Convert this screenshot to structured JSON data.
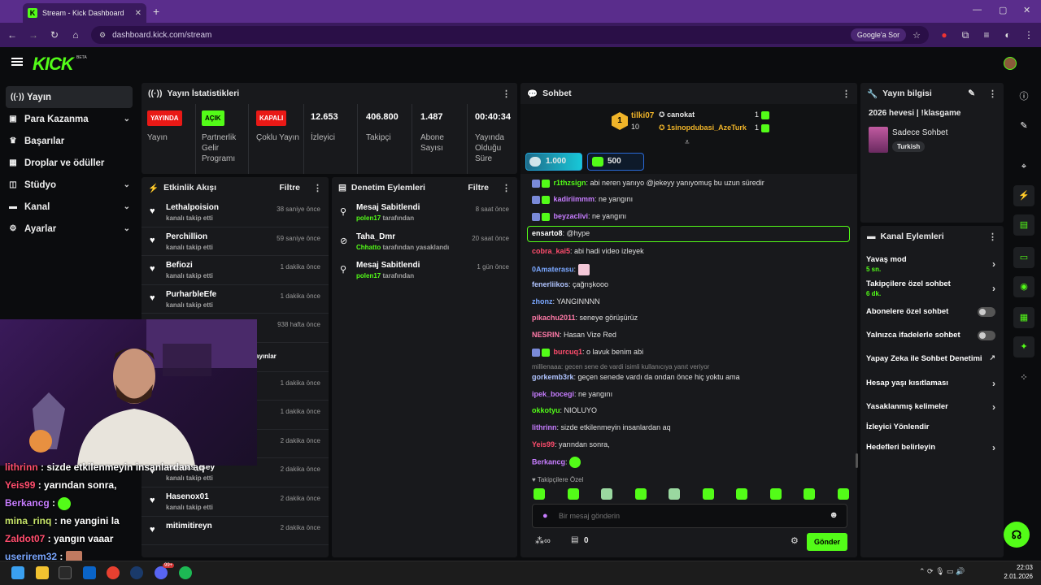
{
  "browser": {
    "tab_title": "Stream - Kick Dashboard",
    "url": "dashboard.kick.com/stream",
    "google_btn": "Google'a Sor"
  },
  "header": {
    "logo": "KICK",
    "beta": "BETA"
  },
  "sidebar": {
    "items": [
      {
        "label": "Yayın",
        "icon": "broadcast-icon",
        "expandable": false,
        "active": true
      },
      {
        "label": "Para Kazanma",
        "icon": "money-icon",
        "expandable": true
      },
      {
        "label": "Başarılar",
        "icon": "trophy-icon",
        "expandable": false
      },
      {
        "label": "Droplar ve ödüller",
        "icon": "gift-icon",
        "expandable": false
      },
      {
        "label": "Stüdyo",
        "icon": "studio-icon",
        "expandable": true
      },
      {
        "label": "Kanal",
        "icon": "channel-icon",
        "expandable": true
      },
      {
        "label": "Ayarlar",
        "icon": "gear-icon",
        "expandable": true
      }
    ]
  },
  "stats": {
    "title": "Yayın İstatistikleri",
    "cols": [
      {
        "badge": "YAYINDA",
        "badge_color": "#e91916",
        "label": "Yayın"
      },
      {
        "badge": "AÇIK",
        "badge_color": "#53fc18",
        "label": "Partnerlik Gelir Programı"
      },
      {
        "badge": "KAPALI",
        "badge_color": "#e91916",
        "label": "Çoklu Yayın"
      },
      {
        "value": "12.653",
        "label": "İzleyici"
      },
      {
        "value": "406.800",
        "label": "Takipçi"
      },
      {
        "value": "1.487",
        "label": "Abone Sayısı"
      },
      {
        "value": "00:40:34",
        "label": "Yayında Olduğu Süre"
      }
    ]
  },
  "activity": {
    "title": "Etkinlik Akışı",
    "filter": "Filtre",
    "items": [
      {
        "name": "Lethalpoision",
        "sub": "kanalı takip etti",
        "time": "38 saniye önce"
      },
      {
        "name": "Perchillion",
        "sub": "kanalı takip etti",
        "time": "59 saniye önce"
      },
      {
        "name": "Befiozi",
        "sub": "kanalı takip etti",
        "time": "1 dakika önce"
      },
      {
        "name": "PurharbleEfe",
        "sub": "kanalı takip etti",
        "time": "1 dakika önce"
      },
      {
        "name": "",
        "sub": "",
        "time": "938 hafta önce"
      },
      {
        "name": "",
        "sub": "",
        "time": ""
      },
      {
        "name": "",
        "sub": "",
        "time": "1 dakika önce"
      },
      {
        "name": "",
        "sub": "",
        "time": "1 dakika önce"
      },
      {
        "name": "",
        "sub": "kanalı takip etti",
        "time": "2 dakika önce"
      },
      {
        "name": "Ananas_Bey",
        "sub": "kanalı takip etti",
        "time": "2 dakika önce"
      },
      {
        "name": "Hasenox01",
        "sub": "kanalı takip etti",
        "time": "2 dakika önce"
      },
      {
        "name": "mitimitireyn",
        "sub": "",
        "time": "2 dakika önce"
      }
    ],
    "fragment": "ayınlar"
  },
  "moderation": {
    "title": "Denetim Eylemleri",
    "filter": "Filtre",
    "items": [
      {
        "title": "Mesaj Sabitlendi",
        "user": "polen17",
        "suffix": "tarafından",
        "time": "8 saat önce",
        "icon": "pin-icon"
      },
      {
        "title": "Taha_Dmr",
        "user": "Chhatto",
        "suffix": "tarafından yasaklandı",
        "time": "20 saat önce",
        "icon": "ban-icon"
      },
      {
        "title": "Mesaj Sabitlendi",
        "user": "polen17",
        "suffix": "tarafından",
        "time": "1 gün önce",
        "icon": "pin-icon"
      }
    ]
  },
  "chat": {
    "title": "Sohbet",
    "leaderboard": {
      "rank": "1",
      "top_name": "tilki07",
      "top_count": "10",
      "rows": [
        {
          "name": "canokat",
          "count": "1"
        },
        {
          "name": "1sinopdubasi_AzeTurk",
          "count": "1"
        }
      ]
    },
    "goals": [
      {
        "value": "1.000"
      },
      {
        "value": "500"
      }
    ],
    "messages": [
      {
        "user": "r1thzsign",
        "color": "#53fc18",
        "text": ": abi neren yanıyo @jekeyy yanıyomuş bu uzun süredir",
        "badge": true
      },
      {
        "user": "kadiriimmm",
        "color": "#c77dff",
        "text": ": ne yangını",
        "badge": true
      },
      {
        "user": "beyzacIivi",
        "color": "#c77dff",
        "text": ": ne yangını",
        "badge": true
      },
      {
        "user": "ensarto8",
        "color": "#ffffff",
        "text": ": @hype",
        "badge": false
      },
      {
        "user": "cobra_kai5",
        "color": "#ff4d6d",
        "text": ": abi hadi video izleyek",
        "badge": false
      },
      {
        "user": "0Amaterasu",
        "color": "#7aa7ff",
        "text": ":",
        "badge": false
      },
      {
        "user": "fenerliikos",
        "color": "#b0c4ff",
        "text": ": çağrışkooo",
        "badge": false
      },
      {
        "user": "zhonz",
        "color": "#7aa7ff",
        "text": ": YANGINNNN",
        "badge": false
      },
      {
        "user": "pikachu2011",
        "color": "#ff7aa8",
        "text": ": seneye görüşürüz",
        "badge": false
      },
      {
        "user": "NESRIN",
        "color": "#ff7aa8",
        "text": ": Hasan Vize Red",
        "badge": false
      },
      {
        "user": "burcuq1",
        "color": "#ff4d6d",
        "text": ": o lavuk benim abi",
        "badge": true
      },
      {
        "user": "gorkemb3rk",
        "color": "#b0c4ff",
        "text": ": geçen senede vardı da ondan önce hiç yoktu ama",
        "badge": false
      },
      {
        "user": "ipek_bocegi",
        "color": "#c77dff",
        "text": ": ne yangını",
        "badge": false
      },
      {
        "user": "okkotyu",
        "color": "#53fc18",
        "text": ": NIOLUYO",
        "badge": false
      },
      {
        "user": "lithrinn",
        "color": "#c77dff",
        "text": ": sizde etkilenmeyin insanlardan aq",
        "badge": false
      },
      {
        "user": "Yeis99",
        "color": "#ff4d6d",
        "text": ": yarından sonra,",
        "badge": false
      },
      {
        "user": "Berkancg",
        "color": "#c77dff",
        "text": ":",
        "badge": false
      }
    ],
    "reply_note": "millienaaa: gecen sene de vardi isimli kullanıcıya yanıt veriyor",
    "followers_only": "Takipçilere Özel",
    "input_placeholder": "Bir mesaj gönderin",
    "points": "0",
    "send": "Gönder"
  },
  "stream_info": {
    "title": "Yayın bilgisi",
    "stream_title": "2026 hevesi | !klasgame",
    "category": "Sadece Sohbet",
    "tag": "Turkish"
  },
  "channel_actions": {
    "title": "Kanal Eylemleri",
    "items": [
      {
        "label": "Yavaş mod",
        "sub": "5 sn.",
        "control": "chevron"
      },
      {
        "label": "Takipçilere özel sohbet",
        "sub": "6 dk.",
        "control": "chevron"
      },
      {
        "label": "Abonelere özel sohbet",
        "sub": "",
        "control": "toggle"
      },
      {
        "label": "Yalnızca ifadelerle sohbet",
        "sub": "",
        "control": "toggle"
      },
      {
        "label": "Yapay Zeka ile Sohbet Denetimi",
        "sub": "",
        "control": "external"
      },
      {
        "label": "Hesap yaşı kısıtlaması",
        "sub": "",
        "control": "chevron"
      },
      {
        "label": "Yasaklanmış kelimeler",
        "sub": "",
        "control": "chevron"
      },
      {
        "label": "İzleyici Yönlendir",
        "sub": "",
        "control": "none"
      },
      {
        "label": "Hedefleri belirleyin",
        "sub": "",
        "control": "chevron"
      }
    ]
  },
  "overlay_chat": [
    {
      "user": "lithrinn",
      "color": "#ff4d6d",
      "text": " : sizde etkilenmeyin insanlardan aq"
    },
    {
      "user": "Yeis99",
      "color": "#ff4d6d",
      "text": " : yarından sonra,"
    },
    {
      "user": "Berkancg",
      "color": "#c77dff",
      "text": " :"
    },
    {
      "user": "mina_rinq",
      "color": "#c8e66a",
      "text": " : ne yangini la"
    },
    {
      "user": "Zaldot07",
      "color": "#ff4d6d",
      "text": " : yangın vaaar"
    },
    {
      "user": "userirem32",
      "color": "#7aa7ff",
      "text": " :"
    }
  ],
  "taskbar": {
    "time": "22:03",
    "date": "2.01.2026",
    "badge": "99+"
  },
  "colors": {
    "accent": "#53fc18",
    "live": "#e91916",
    "panel": "#18191c",
    "bg": "#0b0c0e"
  }
}
